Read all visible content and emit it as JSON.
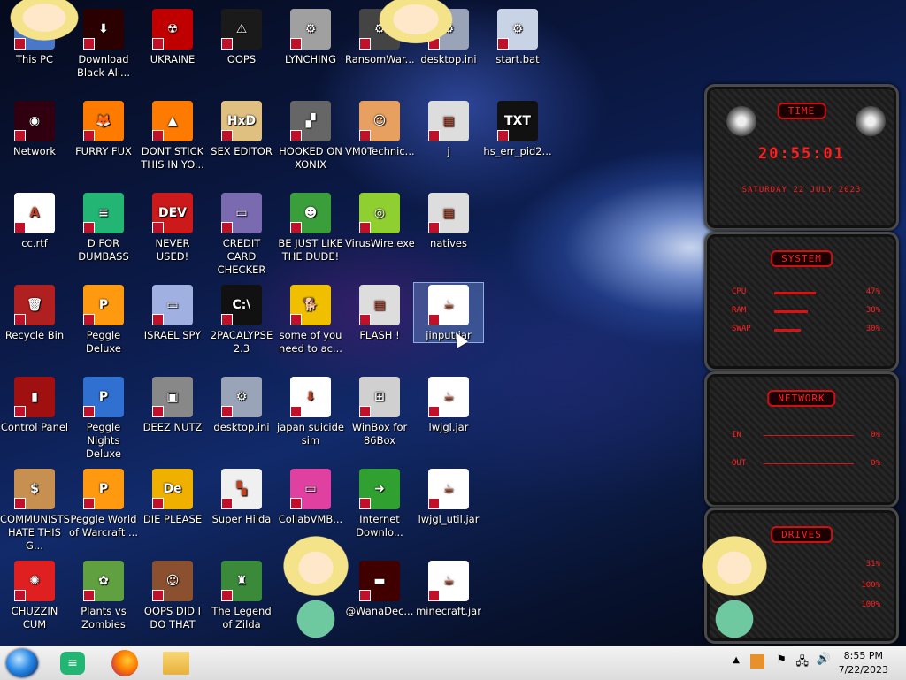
{
  "desktop": {
    "icons": [
      {
        "label": "This PC",
        "glyph": "🖥",
        "bg": "#4a78c8"
      },
      {
        "label": "Download Black Ali...",
        "glyph": "⬇",
        "bg": "#2a0000"
      },
      {
        "label": "UKRAINE",
        "glyph": "☢",
        "bg": "#c00000"
      },
      {
        "label": "OOPS",
        "glyph": "⚠",
        "bg": "#1a1a1a"
      },
      {
        "label": "LYNCHING",
        "glyph": "⚙",
        "bg": "#a0a0a0"
      },
      {
        "label": "RansomWar...",
        "glyph": "⚙",
        "bg": "#444"
      },
      {
        "label": "desktop.ini",
        "glyph": "⚙",
        "bg": "#9aa4b8"
      },
      {
        "label": "start.bat",
        "glyph": "⚙",
        "bg": "#c8d4e6"
      },
      {
        "label": "Network",
        "glyph": "◉",
        "bg": "#300010"
      },
      {
        "label": "FURRY FUX",
        "glyph": "🦊",
        "bg": "#ff7b00"
      },
      {
        "label": "DONT STICK THIS IN YO...",
        "glyph": "▲",
        "bg": "#ff7a00"
      },
      {
        "label": "SEX EDITOR",
        "glyph": "HxD",
        "bg": "#e0c080"
      },
      {
        "label": "HOOKED ON XONIX",
        "glyph": "▞",
        "bg": "#666"
      },
      {
        "label": "VM0Technic...",
        "glyph": "☺",
        "bg": "#e8a060"
      },
      {
        "label": "j",
        "glyph": "▤",
        "bg": "#ddd"
      },
      {
        "label": "hs_err_pid2...",
        "glyph": "TXT",
        "bg": "#111"
      },
      {
        "label": "cc.rtf",
        "glyph": "A",
        "bg": "#fff"
      },
      {
        "label": "D FOR DUMBASS",
        "glyph": "≡",
        "bg": "#22b573"
      },
      {
        "label": "NEVER USED!",
        "glyph": "DEV",
        "bg": "#cc1a1a"
      },
      {
        "label": "CREDIT CARD CHECKER",
        "glyph": "▭",
        "bg": "#7a6ab0"
      },
      {
        "label": "BE JUST LIKE THE DUDE!",
        "glyph": "☻",
        "bg": "#3a9e3a"
      },
      {
        "label": "VirusWire.exe",
        "glyph": "◎",
        "bg": "#8fd030"
      },
      {
        "label": "natives",
        "glyph": "▤",
        "bg": "#ddd"
      },
      {
        "label": "Recycle Bin",
        "glyph": "🗑",
        "bg": "#b02020"
      },
      {
        "label": "Peggle Deluxe",
        "glyph": "P",
        "bg": "#ff9a10"
      },
      {
        "label": "ISRAEL SPY",
        "glyph": "▭",
        "bg": "#a0b0e0"
      },
      {
        "label": "2PACALYPSE 2.3",
        "glyph": "C:\\",
        "bg": "#111"
      },
      {
        "label": "some of you need to ac...",
        "glyph": "🐕",
        "bg": "#f0c000"
      },
      {
        "label": "FLASH !",
        "glyph": "▤",
        "bg": "#ddd"
      },
      {
        "label": "jinput.jar",
        "glyph": "☕",
        "bg": "#fff"
      },
      {
        "label": "Control Panel",
        "glyph": "▮",
        "bg": "#a01010"
      },
      {
        "label": "Peggle Nights Deluxe",
        "glyph": "P",
        "bg": "#3070d0"
      },
      {
        "label": "DEEZ NUTZ",
        "glyph": "▣",
        "bg": "#888"
      },
      {
        "label": "desktop.ini",
        "glyph": "⚙",
        "bg": "#9aa4b8"
      },
      {
        "label": "japan suicide sim",
        "glyph": "⬇",
        "bg": "#fff"
      },
      {
        "label": "WinBox for 86Box",
        "glyph": "⊞",
        "bg": "#d0d0d0"
      },
      {
        "label": "lwjgl.jar",
        "glyph": "☕",
        "bg": "#fff"
      },
      {
        "label": "COMMUNISTS HATE THIS G...",
        "glyph": "$",
        "bg": "#c89050"
      },
      {
        "label": "Peggle World of Warcraft ...",
        "glyph": "P",
        "bg": "#ff9a10"
      },
      {
        "label": "DIE PLEASE",
        "glyph": "De",
        "bg": "#f0b000"
      },
      {
        "label": "Super Hilda",
        "glyph": "▚",
        "bg": "#f0f0f0"
      },
      {
        "label": "CollabVMB...",
        "glyph": "▭",
        "bg": "#e040a0"
      },
      {
        "label": "Internet Downlo...",
        "glyph": "➜",
        "bg": "#30a030"
      },
      {
        "label": "lwjgl_util.jar",
        "glyph": "☕",
        "bg": "#fff"
      },
      {
        "label": "CHUZZIN CUM",
        "glyph": "✺",
        "bg": "#e02020"
      },
      {
        "label": "Plants vs Zombies",
        "glyph": "✿",
        "bg": "#60a040"
      },
      {
        "label": "OOPS DID I DO THAT",
        "glyph": "☺",
        "bg": "#8a5030"
      },
      {
        "label": "The Legend of Zilda",
        "glyph": "♜",
        "bg": "#3a8a3a"
      },
      {
        "label": "",
        "glyph": "",
        "bg": "#000"
      },
      {
        "label": "@WanaDec...",
        "glyph": "▬",
        "bg": "#400000"
      },
      {
        "label": "minecraft.jar",
        "glyph": "☕",
        "bg": "#fff"
      }
    ]
  },
  "gadgets": {
    "time": {
      "title": "TIME",
      "clock": "20:55:01",
      "date": "SATURDAY 22 JULY 2023"
    },
    "system": {
      "title": "SYSTEM",
      "rows": [
        {
          "label": "CPU",
          "value": "47%",
          "fill": 0.47
        },
        {
          "label": "RAM",
          "value": "38%",
          "fill": 0.38
        },
        {
          "label": "SWAP",
          "value": "30%",
          "fill": 0.3
        }
      ]
    },
    "network": {
      "title": "NETWORK",
      "rows": [
        {
          "label": "IN",
          "value": "0%"
        },
        {
          "label": "OUT",
          "value": "0%"
        }
      ]
    },
    "drives": {
      "title": "DRIVES",
      "rows": [
        {
          "label": "C:",
          "value": "31%"
        },
        {
          "label": "",
          "value": "100%"
        },
        {
          "label": "",
          "value": "100%"
        }
      ]
    }
  },
  "taskbar": {
    "time": "8:55 PM",
    "date": "7/22/2023",
    "apps": [
      {
        "name": "start-orb"
      },
      {
        "name": "feedly"
      },
      {
        "name": "firefox"
      },
      {
        "name": "file-explorer"
      }
    ]
  }
}
